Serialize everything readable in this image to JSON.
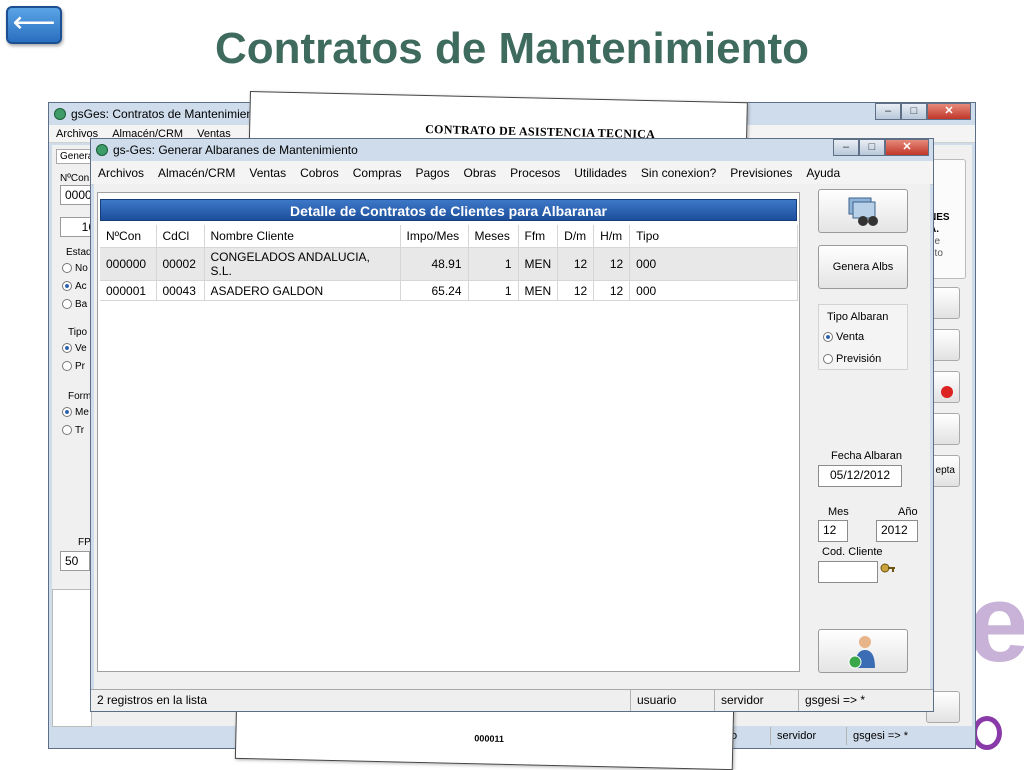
{
  "slide": {
    "back_arrow": "⟵",
    "title": "Contratos de Mantenimiento"
  },
  "back_window": {
    "title": "gsGes: Contratos de Mantenimiento",
    "menu": [
      "Archivos",
      "Almacén/CRM",
      "Ventas"
    ],
    "tab_label": "Genera",
    "fields": {
      "ncon_label": "NºCon",
      "ncon_value": "0000",
      "num_value": "16",
      "fp_label": "FP",
      "fp_value": "50"
    },
    "groups": {
      "estado": {
        "label": "Estad",
        "options": [
          "No",
          "Ac",
          "Ba"
        ]
      },
      "tipo": {
        "label": "Tipo",
        "options": [
          "Ve",
          "Pr"
        ]
      },
      "forma": {
        "label": "Form",
        "options": [
          "Me",
          "Tr"
        ]
      }
    },
    "right_panel_text": [
      "NES",
      "A.",
      "de",
      "nto"
    ],
    "accept_label": "epta",
    "status": {
      "user": "usuario",
      "server": "servidor",
      "db": "gsgesi => *"
    }
  },
  "paper": {
    "title": "CONTRATO DE ASISTENCIA TECNICA",
    "number": "000011"
  },
  "front_window": {
    "title": "gs-Ges: Generar Albaranes de Mantenimiento",
    "menu": [
      "Archivos",
      "Almacén/CRM",
      "Ventas",
      "Cobros",
      "Compras",
      "Pagos",
      "Obras",
      "Procesos",
      "Utilidades",
      "Sin conexion?",
      "Previsiones",
      "Ayuda"
    ],
    "grid": {
      "title": "Detalle de Contratos de Clientes para Albaranar",
      "columns": [
        "NºCon",
        "CdCl",
        "Nombre Cliente",
        "Impo/Mes",
        "Meses",
        "Ffm",
        "D/m",
        "H/m",
        "Tipo"
      ],
      "rows": [
        [
          "000000",
          "00002",
          "CONGELADOS ANDALUCIA, S.L.",
          "48.91",
          "1",
          "MEN",
          "12",
          "12",
          "000"
        ],
        [
          "000001",
          "00043",
          "ASADERO GALDON",
          "65.24",
          "1",
          "MEN",
          "12",
          "12",
          "000"
        ]
      ]
    },
    "side": {
      "generate_label": "Genera Albs",
      "tipo_albaran": {
        "label": "Tipo Albaran",
        "options": [
          "Venta",
          "Previsión"
        ],
        "selected": "Venta"
      },
      "fecha_label": "Fecha Albaran",
      "fecha_value": "05/12/2012",
      "mes_label": "Mes",
      "mes_value": "12",
      "anio_label": "Año",
      "anio_value": "2012",
      "cliente_label": "Cod. Cliente",
      "cliente_value": ""
    },
    "status": {
      "count": "2 registros en la lista",
      "user": "usuario",
      "server": "servidor",
      "db": "gsgesi => *"
    }
  }
}
